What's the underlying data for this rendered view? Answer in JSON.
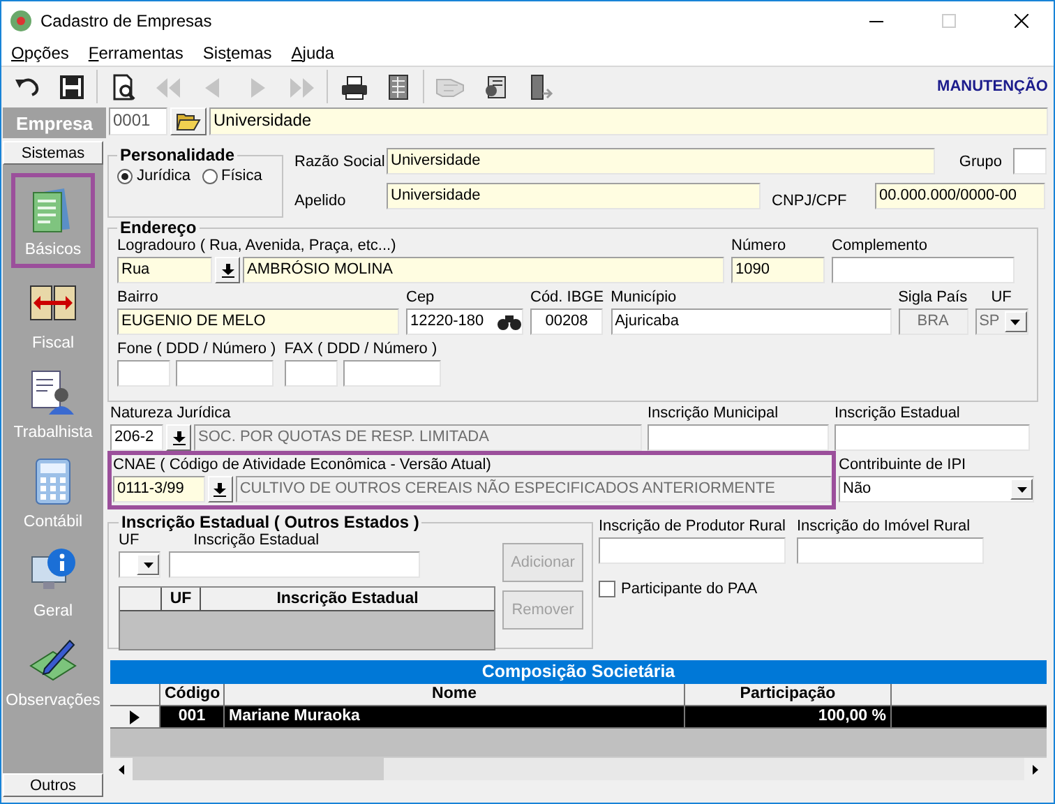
{
  "window": {
    "title": "Cadastro de Empresas"
  },
  "menu": [
    {
      "key": "O",
      "post": "pções"
    },
    {
      "key": "F",
      "post": "erramentas"
    },
    {
      "pre": "Sis",
      "key": "t",
      "post": "emas"
    },
    {
      "key": "A",
      "post": "juda"
    }
  ],
  "toolbar": {
    "buttons": [
      {
        "kind": "undo",
        "disabled": false
      },
      {
        "kind": "save",
        "disabled": false
      },
      {
        "kind": "separator"
      },
      {
        "kind": "preview",
        "disabled": false
      },
      {
        "kind": "first",
        "disabled": true
      },
      {
        "kind": "previous",
        "disabled": true
      },
      {
        "kind": "next",
        "disabled": true
      },
      {
        "kind": "last",
        "disabled": true
      },
      {
        "kind": "separator"
      },
      {
        "kind": "print",
        "disabled": false
      },
      {
        "kind": "report",
        "disabled": false
      },
      {
        "kind": "separator"
      },
      {
        "kind": "hand",
        "disabled": true
      },
      {
        "kind": "contact",
        "disabled": false
      },
      {
        "kind": "exit",
        "disabled": false
      }
    ],
    "mode": "MANUTENÇÃO"
  },
  "empresa": {
    "label": "Empresa",
    "code": "0001",
    "name": "Universidade"
  },
  "sidebar": {
    "header": "Sistemas",
    "items": [
      {
        "kind": "basicos",
        "label": "Básicos",
        "selected": true
      },
      {
        "kind": "fiscal",
        "label": "Fiscal",
        "selected": false
      },
      {
        "kind": "trabalhista",
        "label": "Trabalhista",
        "selected": false
      },
      {
        "kind": "contabil",
        "label": "Contábil",
        "selected": false
      },
      {
        "kind": "geral",
        "label": "Geral",
        "selected": false
      },
      {
        "kind": "observacoes",
        "label": "Observações",
        "selected": false
      }
    ],
    "footer": "Outros"
  },
  "personalidade": {
    "title": "Personalidade",
    "options": [
      {
        "label": "Jurídica",
        "selected": true
      },
      {
        "label": "Física",
        "selected": false
      }
    ]
  },
  "razao_social": {
    "label": "Razão Social",
    "value": "Universidade",
    "required": true
  },
  "grupo": {
    "label": "Grupo"
  },
  "apelido": {
    "label": "Apelido",
    "value": "Universidade",
    "required": true
  },
  "cnpj_cpf": {
    "label": "CNPJ/CPF",
    "value": "00.000.000/0000-00",
    "required": true
  },
  "endereco": {
    "title": "Endereço",
    "logradouro": {
      "label": "Logradouro ( Rua, Avenida, Praça, etc...)",
      "type": {
        "value": "Rua",
        "required": true
      },
      "name": {
        "value": "AMBRÓSIO MOLINA",
        "required": true
      }
    },
    "numero": {
      "label": "Número",
      "value": "1090",
      "required": true
    },
    "complemento": {
      "label": "Complemento"
    },
    "bairro": {
      "label": "Bairro",
      "value": "EUGENIO DE MELO",
      "required": true
    },
    "cep": {
      "label": "Cep",
      "value": "12220-180"
    },
    "cod_ibge": {
      "label": "Cód. IBGE",
      "value": "00208"
    },
    "municipio": {
      "label": "Município",
      "value": "Ajuricaba"
    },
    "sigla_pais": {
      "label": "Sigla País",
      "value": "BRA",
      "disabled": true
    },
    "uf": {
      "label": "UF",
      "value": "SP",
      "disabled": true
    },
    "fone": {
      "label": "Fone ( DDD / Número )"
    },
    "fax": {
      "label": "FAX ( DDD / Número )"
    }
  },
  "natureza_juridica": {
    "label": "Natureza Jurídica",
    "code": {
      "value": "206-2"
    },
    "description": {
      "value": "SOC. POR QUOTAS DE RESP. LIMITADA",
      "disabled": true
    }
  },
  "inscricao_municipal": {
    "label": "Inscrição Municipal"
  },
  "inscricao_estadual": {
    "label": "Inscrição Estadual"
  },
  "cnae": {
    "label": "CNAE ( Código de Atividade Econômica - Versão Atual)",
    "highlighted": true,
    "code": {
      "value": "0111-3/99",
      "required": true
    },
    "description": {
      "value": "CULTIVO DE OUTROS CEREAIS NÃO ESPECIFICADOS ANTERIORMENTE",
      "disabled": true
    }
  },
  "contribuinte_ipi": {
    "label": "Contribuinte de IPI",
    "value": "Não"
  },
  "outros_estados": {
    "title": "Inscrição Estadual ( Outros Estados )",
    "uf_label": "UF",
    "ie_label": "Inscrição Estadual",
    "columns": [
      "UF",
      "Inscrição Estadual"
    ],
    "buttons": [
      {
        "label": "Adicionar",
        "disabled": true
      },
      {
        "label": "Remover",
        "disabled": true
      }
    ]
  },
  "produtor_rural": {
    "label": "Inscrição de Produtor Rural"
  },
  "imovel_rural": {
    "label": "Inscrição do Imóvel Rural"
  },
  "paa": {
    "label": "Participante do PAA",
    "checked": false
  },
  "composicao": {
    "title": "Composição Societária",
    "columns": [
      "Código",
      "Nome",
      "Participação"
    ],
    "rows": [
      {
        "cells": [
          "001",
          "Mariane Muraoka",
          "100,00 %"
        ],
        "selected": true
      }
    ]
  }
}
